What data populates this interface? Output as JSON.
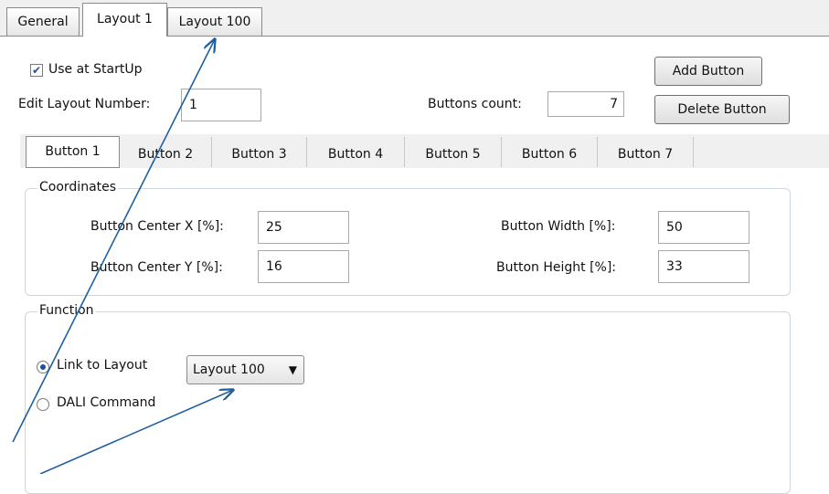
{
  "top_tabs": [
    {
      "label": "General"
    },
    {
      "label": "Layout 1"
    },
    {
      "label": "Layout 100"
    }
  ],
  "use_at_startup": {
    "label": "Use at StartUp",
    "checked": true
  },
  "edit_layout": {
    "label": "Edit Layout Number:",
    "value": "1"
  },
  "buttons_count": {
    "label": "Buttons count:",
    "value": "7"
  },
  "actions": {
    "add": "Add Button",
    "delete": "Delete Button"
  },
  "button_tabs": [
    {
      "label": "Button 1"
    },
    {
      "label": "Button 2"
    },
    {
      "label": "Button 3"
    },
    {
      "label": "Button 4"
    },
    {
      "label": "Button 5"
    },
    {
      "label": "Button 6"
    },
    {
      "label": "Button 7"
    }
  ],
  "coordinates": {
    "title": "Coordinates",
    "center_x_label": "Button Center X [%]:",
    "center_x": "25",
    "center_y_label": "Button Center Y [%]:",
    "center_y": "16",
    "width_label": "Button Width [%]:",
    "width": "50",
    "height_label": "Button Height [%]:",
    "height": "33"
  },
  "function": {
    "title": "Function",
    "link_label": "Link to Layout",
    "link_selected": true,
    "dali_label": "DALI Command",
    "layout_select": "Layout 100",
    "dropdown_arrow": "▼"
  },
  "check_glyph": "✔",
  "annotation_color": "#1f5f9e"
}
